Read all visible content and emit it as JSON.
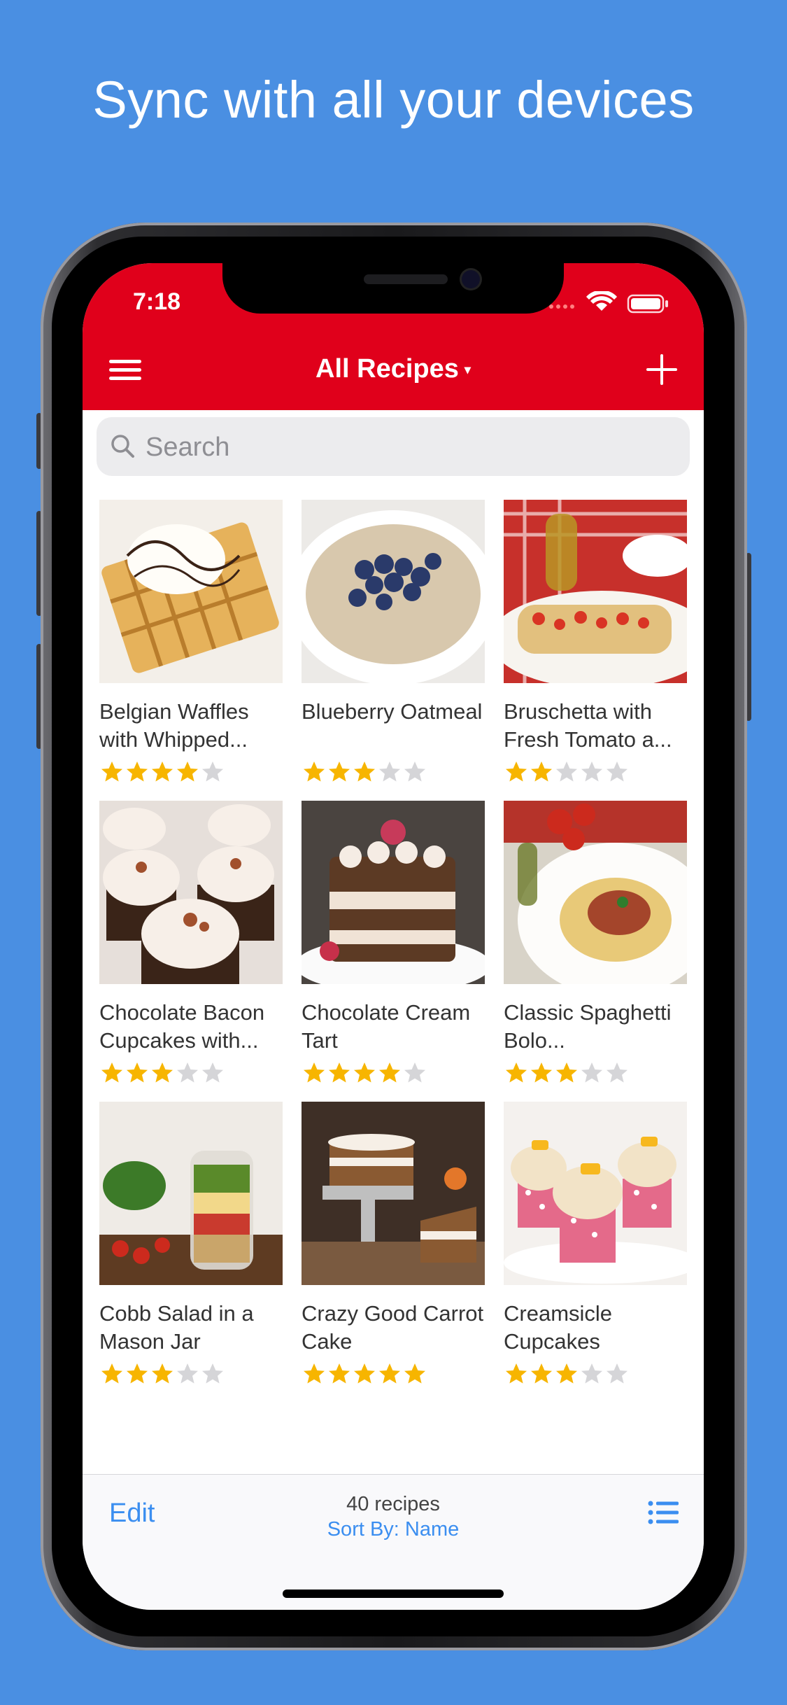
{
  "headline": "Sync with all your devices",
  "status_bar": {
    "time": "7:18"
  },
  "nav": {
    "title": "All Recipes",
    "caret": "▾"
  },
  "search": {
    "placeholder": "Search"
  },
  "recipes": [
    {
      "title": "Belgian Waffles with Whipped...",
      "rating": 4
    },
    {
      "title": "Blueberry Oatmeal",
      "rating": 3
    },
    {
      "title": "Bruschetta with Fresh Tomato a...",
      "rating": 2
    },
    {
      "title": "Chocolate Bacon Cupcakes with...",
      "rating": 3
    },
    {
      "title": "Chocolate Cream Tart",
      "rating": 4
    },
    {
      "title": "Classic Spaghetti Bolo...",
      "rating": 3
    },
    {
      "title": "Cobb Salad in a Mason Jar",
      "rating": 3
    },
    {
      "title": "Crazy Good Carrot Cake",
      "rating": 5
    },
    {
      "title": "Creamsicle Cupcakes",
      "rating": 3
    },
    {
      "title": "",
      "rating": 0
    },
    {
      "title": "",
      "rating": 0
    },
    {
      "title": "",
      "rating": 0
    }
  ],
  "toolbar": {
    "edit_label": "Edit",
    "count": "40 recipes",
    "sort_label": "Sort By: Name"
  },
  "colors": {
    "background": "#4a8fe2",
    "header": "#e0001b",
    "accent": "#3b8ef0",
    "star_on": "#f7b500",
    "star_off": "#d5d5d8"
  },
  "icons": {
    "menu": "hamburger-icon",
    "add": "plus-icon",
    "search": "magnifier-icon",
    "list": "list-icon",
    "wifi": "wifi-icon",
    "battery": "battery-icon"
  }
}
